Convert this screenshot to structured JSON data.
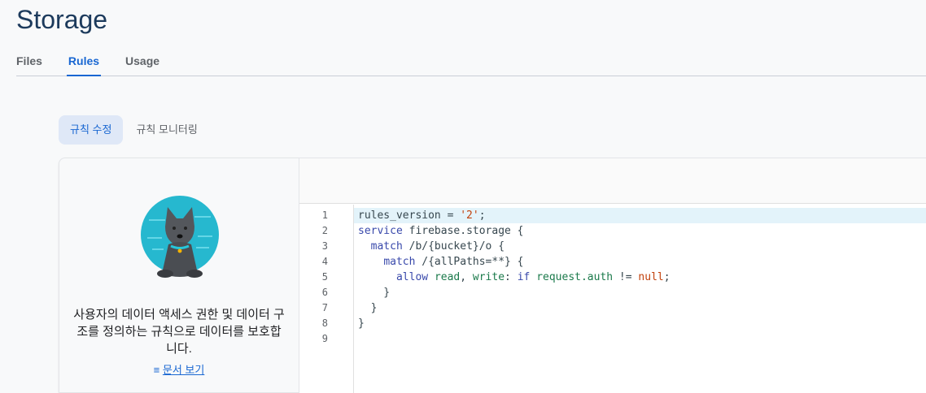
{
  "header": {
    "title": "Storage"
  },
  "tabs": [
    {
      "label": "Files"
    },
    {
      "label": "Rules"
    },
    {
      "label": "Usage"
    }
  ],
  "segments": [
    {
      "label": "규칙 수정"
    },
    {
      "label": "규칙 모니터링"
    }
  ],
  "info": {
    "description": "사용자의 데이터 액세스 권한 및 데이터 구조를 정의하는 규칙으로 데이터를 보호합니다.",
    "doc_link": "문서 보기",
    "doc_icon": "notes-icon"
  },
  "colors": {
    "accent": "#1967d2",
    "highlight": "#e3f3fa"
  },
  "editor": {
    "line_numbers": [
      "1",
      "2",
      "3",
      "4",
      "5",
      "6",
      "7",
      "8",
      "9"
    ],
    "lines": [
      [
        {
          "t": "rules_version = ",
          "c": ""
        },
        {
          "t": "'2'",
          "c": "str"
        },
        {
          "t": ";",
          "c": ""
        }
      ],
      [
        {
          "t": "service",
          "c": "kw"
        },
        {
          "t": " firebase.storage {",
          "c": ""
        }
      ],
      [
        {
          "t": "  ",
          "c": ""
        },
        {
          "t": "match",
          "c": "kw"
        },
        {
          "t": " /b/{bucket}/o {",
          "c": ""
        }
      ],
      [
        {
          "t": "    ",
          "c": ""
        },
        {
          "t": "match",
          "c": "kw"
        },
        {
          "t": " /{allPaths=**} {",
          "c": ""
        }
      ],
      [
        {
          "t": "      ",
          "c": ""
        },
        {
          "t": "allow",
          "c": "kw"
        },
        {
          "t": " ",
          "c": ""
        },
        {
          "t": "read",
          "c": "id"
        },
        {
          "t": ", ",
          "c": ""
        },
        {
          "t": "write",
          "c": "id"
        },
        {
          "t": ": ",
          "c": ""
        },
        {
          "t": "if",
          "c": "kw"
        },
        {
          "t": " ",
          "c": ""
        },
        {
          "t": "request.auth",
          "c": "id"
        },
        {
          "t": " != ",
          "c": ""
        },
        {
          "t": "null",
          "c": "nul"
        },
        {
          "t": ";",
          "c": ""
        }
      ],
      [
        {
          "t": "    }",
          "c": ""
        }
      ],
      [
        {
          "t": "  }",
          "c": ""
        }
      ],
      [
        {
          "t": "}",
          "c": ""
        }
      ],
      [
        {
          "t": "",
          "c": ""
        }
      ]
    ]
  }
}
